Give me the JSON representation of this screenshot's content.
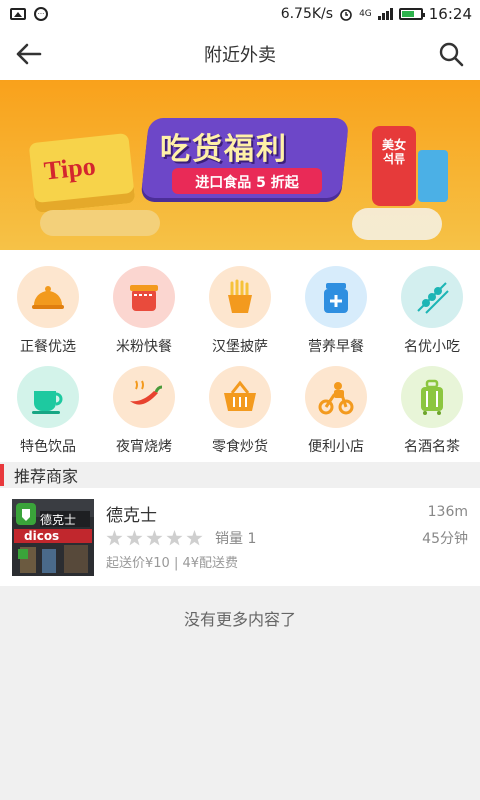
{
  "status_bar": {
    "speed": "6.75K/s",
    "network": "4G",
    "time": "16:24"
  },
  "header": {
    "title": "附近外卖",
    "back_icon": "arrow-left-icon",
    "search_icon": "search-icon"
  },
  "banner": {
    "slogan": "吃货福利",
    "subtitle": "进口食品 5 折起",
    "brand": "Tipo",
    "can_label": "美女 석류",
    "page_count": 2
  },
  "categories": [
    {
      "label": "正餐优选",
      "icon": "cloche-icon",
      "bg": "#fde6cf",
      "color": "#f29a1e"
    },
    {
      "label": "米粉快餐",
      "icon": "noodle-jar-icon",
      "bg": "#fbd6d0",
      "color": "#e94b3c"
    },
    {
      "label": "汉堡披萨",
      "icon": "fries-icon",
      "bg": "#fde6cf",
      "color": "#f39a1e"
    },
    {
      "label": "营养早餐",
      "icon": "milk-bottle-icon",
      "bg": "#d7ecfb",
      "color": "#2f8fe0"
    },
    {
      "label": "名优小吃",
      "icon": "skewer-icon",
      "bg": "#d3efef",
      "color": "#1db5b5"
    },
    {
      "label": "特色饮品",
      "icon": "coffee-cup-icon",
      "bg": "#d3f3ea",
      "color": "#1ec9a0"
    },
    {
      "label": "夜宵烧烤",
      "icon": "chili-pepper-icon",
      "bg": "#fde6cf",
      "color": "#e8432f"
    },
    {
      "label": "零食炒货",
      "icon": "basket-icon",
      "bg": "#fde6cf",
      "color": "#f39a1e"
    },
    {
      "label": "便利小店",
      "icon": "delivery-bike-icon",
      "bg": "#fde6cf",
      "color": "#f39a1e"
    },
    {
      "label": "名酒名茶",
      "icon": "luggage-icon",
      "bg": "#e8f5d8",
      "color": "#8cc63f"
    }
  ],
  "section": {
    "title": "推荐商家"
  },
  "shops": [
    {
      "name": "德克士",
      "distance": "136m",
      "rating": 0,
      "sales": "销量 1",
      "delivery_time": "45分钟",
      "fee": "起送价¥10 | 4¥配送费",
      "logo_cn": "德克士",
      "logo_en": "dicos"
    }
  ],
  "footer": {
    "no_more": "没有更多内容了"
  },
  "colors": {
    "accent": "#e8393c",
    "star_empty": "#cfcfcf",
    "banner": "#f9a11b"
  }
}
